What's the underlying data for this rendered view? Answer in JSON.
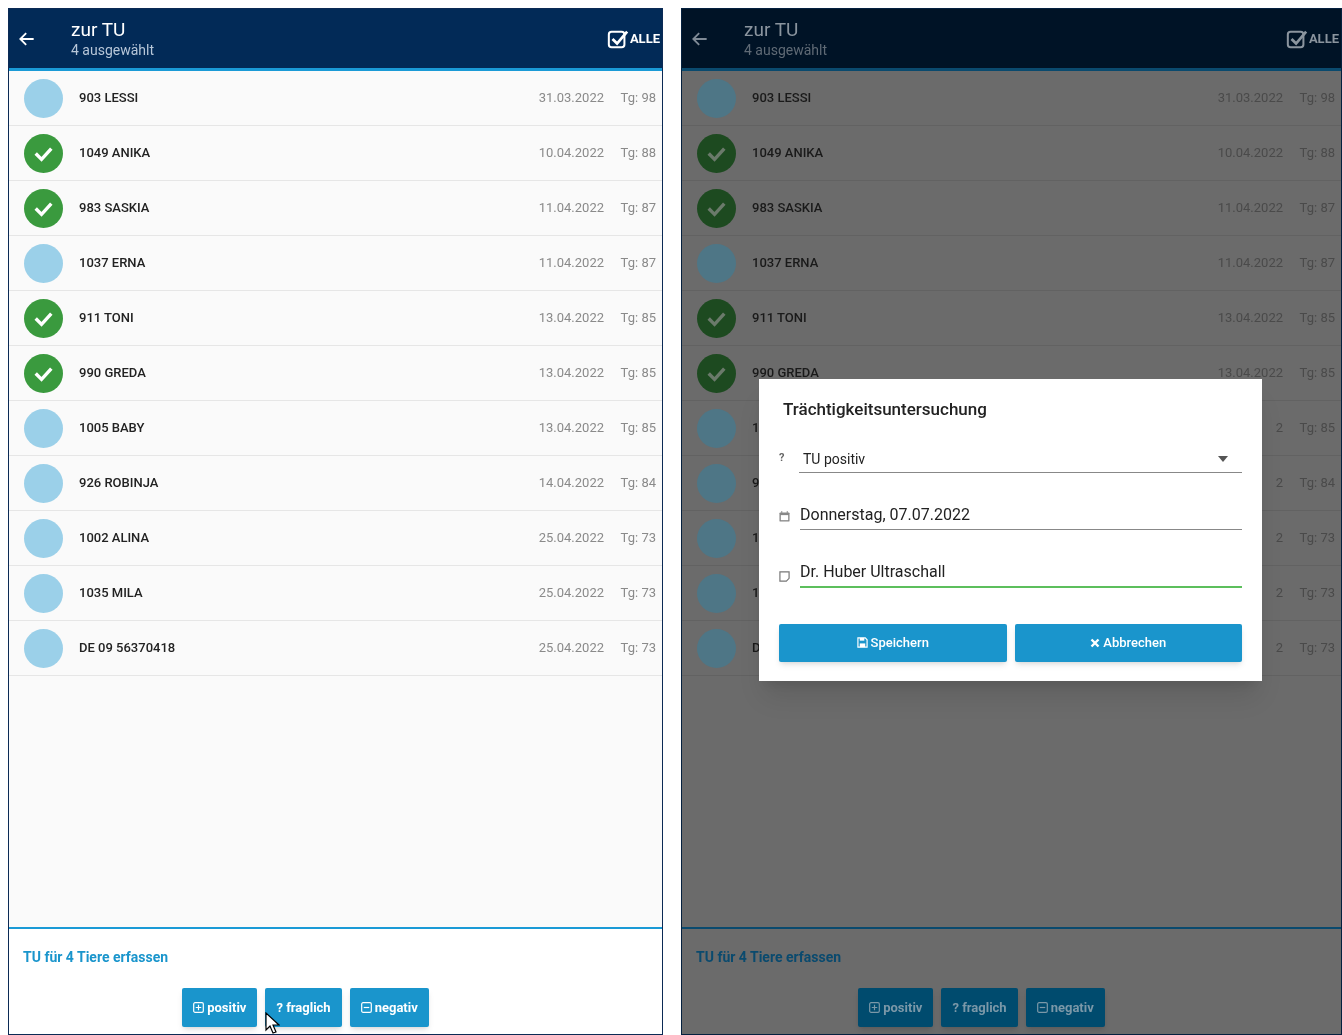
{
  "screens": [
    {
      "header": {
        "title": "zur TU",
        "subtitle": "4 ausgewählt",
        "select_all": "ALLE"
      },
      "rows": [
        {
          "name": "903 LESSI",
          "date": "31.03.2022",
          "tg": "Tg: 98",
          "selected": false
        },
        {
          "name": "1049 ANIKA",
          "date": "10.04.2022",
          "tg": "Tg: 88",
          "selected": true
        },
        {
          "name": "983 SASKIA",
          "date": "11.04.2022",
          "tg": "Tg: 87",
          "selected": true
        },
        {
          "name": "1037 ERNA",
          "date": "11.04.2022",
          "tg": "Tg: 87",
          "selected": false
        },
        {
          "name": "911 TONI",
          "date": "13.04.2022",
          "tg": "Tg: 85",
          "selected": true
        },
        {
          "name": "990 GREDA",
          "date": "13.04.2022",
          "tg": "Tg: 85",
          "selected": true
        },
        {
          "name": "1005 BABY",
          "date": "13.04.2022",
          "tg": "Tg: 85",
          "selected": false
        },
        {
          "name": "926 ROBINJA",
          "date": "14.04.2022",
          "tg": "Tg: 84",
          "selected": false
        },
        {
          "name": "1002 ALINA",
          "date": "25.04.2022",
          "tg": "Tg: 73",
          "selected": false
        },
        {
          "name": "1035 MILA",
          "date": "25.04.2022",
          "tg": "Tg: 73",
          "selected": false
        },
        {
          "name": "DE 09 56370418",
          "date": "25.04.2022",
          "tg": "Tg: 73",
          "selected": false
        }
      ],
      "footer": {
        "caption": "TU für 4 Tiere erfassen",
        "buttons": [
          {
            "kind": "plus",
            "label": "positiv"
          },
          {
            "kind": "question",
            "icon": "?",
            "label": "fraglich"
          },
          {
            "kind": "minus",
            "label": "negativ"
          }
        ]
      }
    },
    {
      "header": {
        "title": "zur TU",
        "subtitle": "4 ausgewählt",
        "select_all": "ALLE"
      },
      "rows": [
        {
          "name": "903 LESSI",
          "date": "31.03.2022",
          "tg": "Tg: 98",
          "selected": false
        },
        {
          "name": "1049 ANIKA",
          "date": "10.04.2022",
          "tg": "Tg: 88",
          "selected": true
        },
        {
          "name": "983 SASKIA",
          "date": "11.04.2022",
          "tg": "Tg: 87",
          "selected": true
        },
        {
          "name": "1037 ERNA",
          "date": "11.04.2022",
          "tg": "Tg: 87",
          "selected": false
        },
        {
          "name": "911 TONI",
          "date": "13.04.2022",
          "tg": "Tg: 85",
          "selected": true
        },
        {
          "name": "990 GREDA",
          "date": "13.04.2022",
          "tg": "Tg: 85",
          "selected": true
        },
        {
          "name": "1",
          "date": "2",
          "tg": "Tg: 85",
          "selected": false
        },
        {
          "name": "9",
          "date": "2",
          "tg": "Tg: 84",
          "selected": false
        },
        {
          "name": "1",
          "date": "2",
          "tg": "Tg: 73",
          "selected": false
        },
        {
          "name": "1",
          "date": "2",
          "tg": "Tg: 73",
          "selected": false
        },
        {
          "name": "D",
          "date": "2",
          "tg": "Tg: 73",
          "selected": false
        }
      ],
      "footer": {
        "caption": "TU für 4 Tiere erfassen",
        "buttons": [
          {
            "kind": "plus",
            "label": "positiv"
          },
          {
            "kind": "question",
            "icon": "?",
            "label": "fraglich"
          },
          {
            "kind": "minus",
            "label": "negativ"
          }
        ]
      },
      "dialog": {
        "title": "Trächtigkeitsuntersuchung",
        "fields": [
          {
            "kind": "select",
            "icon": "?",
            "value": "TU positiv",
            "focused": false
          },
          {
            "kind": "date",
            "value": "Donnerstag, 07.07.2022",
            "focused": false
          },
          {
            "kind": "note",
            "value": "Dr. Huber Ultraschall",
            "focused": true
          }
        ],
        "buttons": [
          {
            "kind": "save",
            "label": "Speichern"
          },
          {
            "kind": "cancel",
            "label": "Abbrechen"
          }
        ]
      }
    }
  ]
}
